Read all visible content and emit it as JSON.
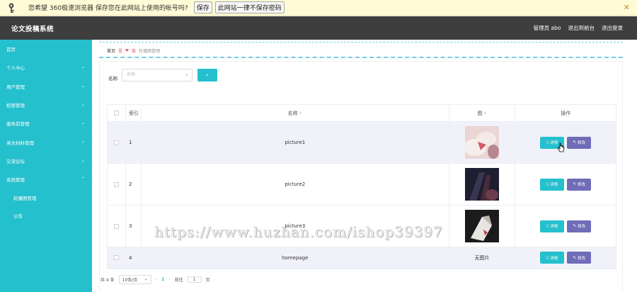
{
  "password_bar": {
    "message": "您希望 360极速浏览器 保存您在此网站上使用的帐号吗?",
    "save_label": "保存",
    "never_label": "此网站一律不保存密码",
    "close_glyph": "✕"
  },
  "header": {
    "title": "论文投稿系统",
    "admin": "管理员 abo",
    "backstage": "退出到前台",
    "logout": "退出登录"
  },
  "sidebar": {
    "items": [
      {
        "label": "首页",
        "chevron": ""
      },
      {
        "label": "个人中心",
        "chevron": "⌄"
      },
      {
        "label": "用户管理",
        "chevron": "⌄"
      },
      {
        "label": "权限管理",
        "chevron": "⌄"
      },
      {
        "label": "服务前管理",
        "chevron": "⌄"
      },
      {
        "label": "英文材料管理",
        "chevron": "⌄"
      },
      {
        "label": "交流论坛",
        "chevron": "⌄"
      },
      {
        "label": "系统管理",
        "chevron": "⌃"
      }
    ],
    "subitems": [
      {
        "label": "轮播图管理"
      },
      {
        "label": "公告"
      }
    ]
  },
  "breadcrumb": {
    "home": "首页",
    "heart_left": "呈",
    "heart": "❤",
    "heart_right": "各",
    "current": "轮播图管理"
  },
  "search": {
    "label": "名称",
    "placeholder": "名称",
    "button_glyph": "⌕"
  },
  "table": {
    "headers": {
      "index": "索引",
      "name": "名称",
      "image": "图",
      "op": "操作"
    },
    "rows": [
      {
        "index": "1",
        "name": "picture1",
        "image": "thumb",
        "detail": "详情",
        "edit": "修改"
      },
      {
        "index": "2",
        "name": "picture2",
        "image": "thumb",
        "detail": "详情",
        "edit": "修改"
      },
      {
        "index": "3",
        "name": "picture3",
        "image": "thumb",
        "detail": "详情",
        "edit": "修改"
      },
      {
        "index": "4",
        "name": "homepage",
        "image": "无图片",
        "detail": "详情",
        "edit": "修改"
      }
    ]
  },
  "pager": {
    "total": "共 4 条",
    "page_size": "10条/页",
    "current": "1",
    "goto": "前往",
    "goto_value": "1",
    "page_unit": "页"
  },
  "watermark": "https://www.huzhan.com/ishop39397",
  "colors": {
    "accent": "#25c0cd",
    "edit_button": "#6f6cb8",
    "header_bg": "#3e3e3e"
  }
}
